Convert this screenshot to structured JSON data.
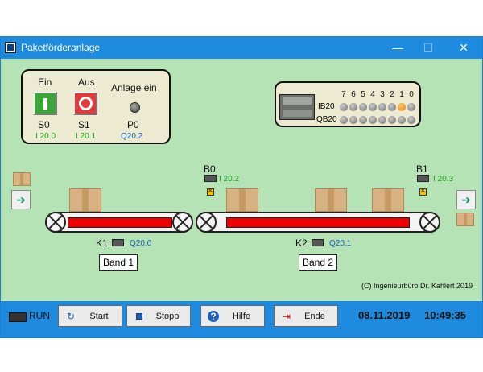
{
  "window": {
    "title": "Paketförderanlage"
  },
  "control_panel": {
    "s0": {
      "top": "Ein",
      "name": "S0",
      "addr": "I 20.0"
    },
    "s1": {
      "top": "Aus",
      "name": "S1",
      "addr": "I 20.1"
    },
    "p0": {
      "top": "Anlage ein",
      "name": "P0",
      "addr": "Q20.2"
    }
  },
  "plc": {
    "bits": [
      "7",
      "6",
      "5",
      "4",
      "3",
      "2",
      "1",
      "0"
    ],
    "ib_label": "IB20",
    "qb_label": "QB20",
    "ib_active_bit": "1"
  },
  "sensors": {
    "b0": {
      "name": "B0",
      "addr": "I 20.2"
    },
    "b1": {
      "name": "B1",
      "addr": "I 20.3"
    }
  },
  "motors": {
    "k1": {
      "name": "K1",
      "addr": "Q20.0"
    },
    "k2": {
      "name": "K2",
      "addr": "Q20.1"
    }
  },
  "bands": {
    "band1": "Band 1",
    "band2": "Band 2"
  },
  "copyright": "(C) Ingenieurbüro Dr. Kahlert 2019",
  "status": {
    "run": "RUN",
    "date": "08.11.2019",
    "time": "10:49:35"
  },
  "buttons": {
    "start": "Start",
    "stopp": "Stopp",
    "hilfe": "Hilfe",
    "ende": "Ende"
  },
  "colors": {
    "titlebar": "#1e8bde",
    "background": "#b5e3b5",
    "belt": "#e00000"
  }
}
